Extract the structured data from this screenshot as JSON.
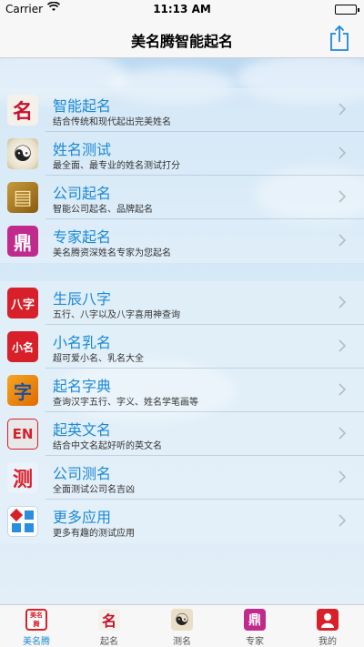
{
  "status_bar": {
    "carrier": "Carrier",
    "time": "11:13 AM"
  },
  "nav": {
    "title": "美名腾智能起名"
  },
  "groups": [
    {
      "items": [
        {
          "title": "智能起名",
          "subtitle": "结合传统和现代起出完美姓名",
          "icon": "calligraphy-name-icon",
          "glyph": "名"
        },
        {
          "title": "姓名测试",
          "subtitle": "最全面、最专业的姓名测试打分",
          "icon": "yin-yang-icon",
          "glyph": "☯"
        },
        {
          "title": "公司起名",
          "subtitle": "智能公司起名、品牌起名",
          "icon": "company-plaque-icon",
          "glyph": "▤"
        },
        {
          "title": "专家起名",
          "subtitle": "美名腾资深姓名专家为您起名",
          "icon": "expert-seal-icon",
          "glyph": "鼎"
        }
      ]
    },
    {
      "items": [
        {
          "title": "生辰八字",
          "subtitle": "五行、八字以及八字喜用神查询",
          "icon": "bazi-icon",
          "glyph": "八字"
        },
        {
          "title": "小名乳名",
          "subtitle": "超可爱小名、乳名大全",
          "icon": "nickname-icon",
          "glyph": "小名"
        },
        {
          "title": "起名字典",
          "subtitle": "查询汉字五行、字义、姓名学笔画等",
          "icon": "dictionary-icon",
          "glyph": "字"
        },
        {
          "title": "起英文名",
          "subtitle": "结合中文名起好听的英文名",
          "icon": "english-name-icon",
          "glyph": "EN"
        },
        {
          "title": "公司测名",
          "subtitle": "全面测试公司名吉凶",
          "icon": "company-test-icon",
          "glyph": "测"
        },
        {
          "title": "更多应用",
          "subtitle": "更多有趣的测试应用",
          "icon": "more-apps-icon",
          "glyph": ""
        }
      ]
    }
  ],
  "tabs": [
    {
      "label": "美名腾",
      "icon": "brand-logo-icon",
      "glyph": "美名腾"
    },
    {
      "label": "起名",
      "icon": "naming-tab-icon",
      "glyph": "名"
    },
    {
      "label": "测名",
      "icon": "test-tab-icon",
      "glyph": "☯"
    },
    {
      "label": "专家",
      "icon": "expert-tab-icon",
      "glyph": "鼎"
    },
    {
      "label": "我的",
      "icon": "profile-tab-icon",
      "glyph": ""
    }
  ],
  "colors": {
    "accent": "#1c8ad6",
    "nav_background": "#f7f7f7",
    "content_background": "#cfe3f2"
  }
}
